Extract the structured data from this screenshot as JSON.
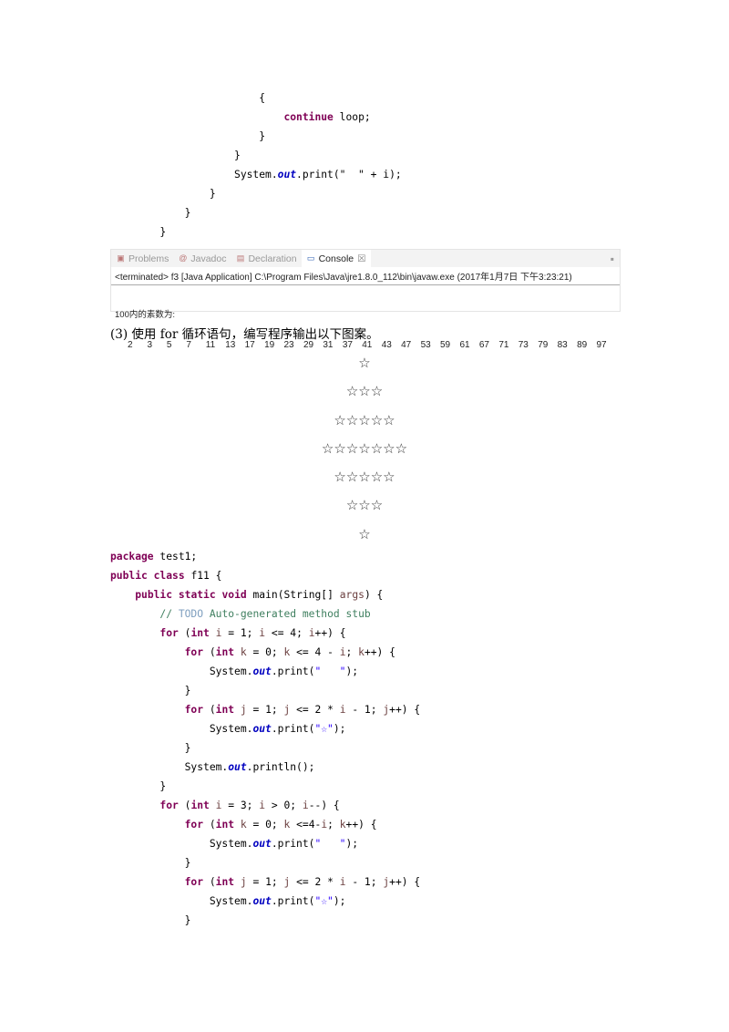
{
  "code_top": [
    [
      6,
      [
        [
          "{",
          ""
        ]
      ]
    ],
    [
      7,
      [
        [
          "continue",
          "kw"
        ],
        [
          " loop;",
          ""
        ]
      ]
    ],
    [
      6,
      [
        [
          "}",
          ""
        ]
      ]
    ],
    [
      5,
      [
        [
          "}",
          ""
        ]
      ]
    ],
    [
      5,
      [
        [
          "System.",
          ""
        ],
        [
          "out",
          "fld"
        ],
        [
          ".print(\"  \" + i);",
          ""
        ]
      ]
    ],
    [
      4,
      [
        [
          "}",
          ""
        ]
      ]
    ],
    [
      3,
      [
        [
          "}",
          ""
        ]
      ]
    ],
    [
      2,
      [
        [
          "}",
          ""
        ]
      ]
    ]
  ],
  "console": {
    "tabs": [
      {
        "label": "Problems",
        "icon": "problems-icon"
      },
      {
        "label": "Javadoc",
        "icon": "javadoc-icon"
      },
      {
        "label": "Declaration",
        "icon": "declaration-icon"
      },
      {
        "label": "Console",
        "icon": "console-icon",
        "active": true
      }
    ],
    "close": "☒",
    "terminated": "<terminated> f3 [Java Application] C:\\Program Files\\Java\\jre1.8.0_112\\bin\\javaw.exe (2017年1月7日 下午3:23:21)",
    "output_label": "100内的素数为:",
    "numbers": [
      "2",
      "3",
      "5",
      "7",
      "11",
      "13",
      "17",
      "19",
      "23",
      "29",
      "31",
      "37",
      "41",
      "43",
      "47",
      "53",
      "59",
      "61",
      "67",
      "71",
      "73",
      "79",
      "83",
      "89",
      "97"
    ]
  },
  "heading": "(3) 使用 for 循环语句，编写程序输出以下图案。",
  "stars": [
    "☆",
    "☆☆☆",
    "☆☆☆☆☆",
    "☆☆☆☆☆☆☆",
    "☆☆☆☆☆",
    "☆☆☆",
    "☆"
  ],
  "code_bottom": [
    [
      0,
      [
        [
          "package",
          "kw"
        ],
        [
          " test1;",
          ""
        ]
      ]
    ],
    [
      0,
      [
        [
          "public",
          "kw"
        ],
        [
          " ",
          ""
        ],
        [
          "class",
          "kw"
        ],
        [
          " f11 {",
          ""
        ]
      ]
    ],
    [
      1,
      [
        [
          "public",
          "kw"
        ],
        [
          " ",
          ""
        ],
        [
          "static",
          "kw"
        ],
        [
          " ",
          ""
        ],
        [
          "void",
          "kw"
        ],
        [
          " main(String[] ",
          ""
        ],
        [
          "args",
          "var"
        ],
        [
          ") {",
          ""
        ]
      ]
    ],
    [
      2,
      [
        [
          "// ",
          "cmt"
        ],
        [
          "TODO",
          "todo"
        ],
        [
          " Auto-generated method stub",
          "cmt"
        ]
      ]
    ],
    [
      2,
      [
        [
          "for",
          "kw"
        ],
        [
          " (",
          ""
        ],
        [
          "int",
          "kw"
        ],
        [
          " ",
          ""
        ],
        [
          "i",
          "var"
        ],
        [
          " = 1; ",
          ""
        ],
        [
          "i",
          "var"
        ],
        [
          " <= 4; ",
          ""
        ],
        [
          "i",
          "var"
        ],
        [
          "++) {",
          ""
        ]
      ]
    ],
    [
      3,
      [
        [
          "for",
          "kw"
        ],
        [
          " (",
          ""
        ],
        [
          "int",
          "kw"
        ],
        [
          " ",
          ""
        ],
        [
          "k",
          "var"
        ],
        [
          " = 0; ",
          ""
        ],
        [
          "k",
          "var"
        ],
        [
          " <= 4 - ",
          ""
        ],
        [
          "i",
          "var"
        ],
        [
          "; ",
          ""
        ],
        [
          "k",
          "var"
        ],
        [
          "++) {",
          ""
        ]
      ]
    ],
    [
      4,
      [
        [
          "System.",
          ""
        ],
        [
          "out",
          "fld"
        ],
        [
          ".print(",
          ""
        ],
        [
          "\"   \"",
          "str"
        ],
        [
          ");",
          ""
        ]
      ]
    ],
    [
      3,
      [
        [
          "}",
          ""
        ]
      ]
    ],
    [
      3,
      [
        [
          "for",
          "kw"
        ],
        [
          " (",
          ""
        ],
        [
          "int",
          "kw"
        ],
        [
          " ",
          ""
        ],
        [
          "j",
          "var"
        ],
        [
          " = 1; ",
          ""
        ],
        [
          "j",
          "var"
        ],
        [
          " <= 2 * ",
          ""
        ],
        [
          "i",
          "var"
        ],
        [
          " - 1; ",
          ""
        ],
        [
          "j",
          "var"
        ],
        [
          "++) {",
          ""
        ]
      ]
    ],
    [
      4,
      [
        [
          "System.",
          ""
        ],
        [
          "out",
          "fld"
        ],
        [
          ".print(",
          ""
        ],
        [
          "\"☆\"",
          "str"
        ],
        [
          ");",
          ""
        ]
      ]
    ],
    [
      3,
      [
        [
          "}",
          ""
        ]
      ]
    ],
    [
      3,
      [
        [
          "System.",
          ""
        ],
        [
          "out",
          "fld"
        ],
        [
          ".println();",
          ""
        ]
      ]
    ],
    [
      2,
      [
        [
          "}",
          ""
        ]
      ]
    ],
    [
      2,
      [
        [
          "for",
          "kw"
        ],
        [
          " (",
          ""
        ],
        [
          "int",
          "kw"
        ],
        [
          " ",
          ""
        ],
        [
          "i",
          "var"
        ],
        [
          " = 3; ",
          ""
        ],
        [
          "i",
          "var"
        ],
        [
          " > 0; ",
          ""
        ],
        [
          "i",
          "var"
        ],
        [
          "--) {",
          ""
        ]
      ]
    ],
    [
      3,
      [
        [
          "for",
          "kw"
        ],
        [
          " (",
          ""
        ],
        [
          "int",
          "kw"
        ],
        [
          " ",
          ""
        ],
        [
          "k",
          "var"
        ],
        [
          " = 0; ",
          ""
        ],
        [
          "k",
          "var"
        ],
        [
          " <=4-",
          ""
        ],
        [
          "i",
          "var"
        ],
        [
          "; ",
          ""
        ],
        [
          "k",
          "var"
        ],
        [
          "++) {",
          ""
        ]
      ]
    ],
    [
      4,
      [
        [
          "System.",
          ""
        ],
        [
          "out",
          "fld"
        ],
        [
          ".print(",
          ""
        ],
        [
          "\"   \"",
          "str"
        ],
        [
          ");",
          ""
        ]
      ]
    ],
    [
      3,
      [
        [
          "}",
          ""
        ]
      ]
    ],
    [
      3,
      [
        [
          "for",
          "kw"
        ],
        [
          " (",
          ""
        ],
        [
          "int",
          "kw"
        ],
        [
          " ",
          ""
        ],
        [
          "j",
          "var"
        ],
        [
          " = 1; ",
          ""
        ],
        [
          "j",
          "var"
        ],
        [
          " <= 2 * ",
          ""
        ],
        [
          "i",
          "var"
        ],
        [
          " - 1; ",
          ""
        ],
        [
          "j",
          "var"
        ],
        [
          "++) {",
          ""
        ]
      ]
    ],
    [
      4,
      [
        [
          "System.",
          ""
        ],
        [
          "out",
          "fld"
        ],
        [
          ".print(",
          ""
        ],
        [
          "\"☆\"",
          "str"
        ],
        [
          ");",
          ""
        ]
      ]
    ],
    [
      3,
      [
        [
          "}",
          ""
        ]
      ]
    ]
  ]
}
